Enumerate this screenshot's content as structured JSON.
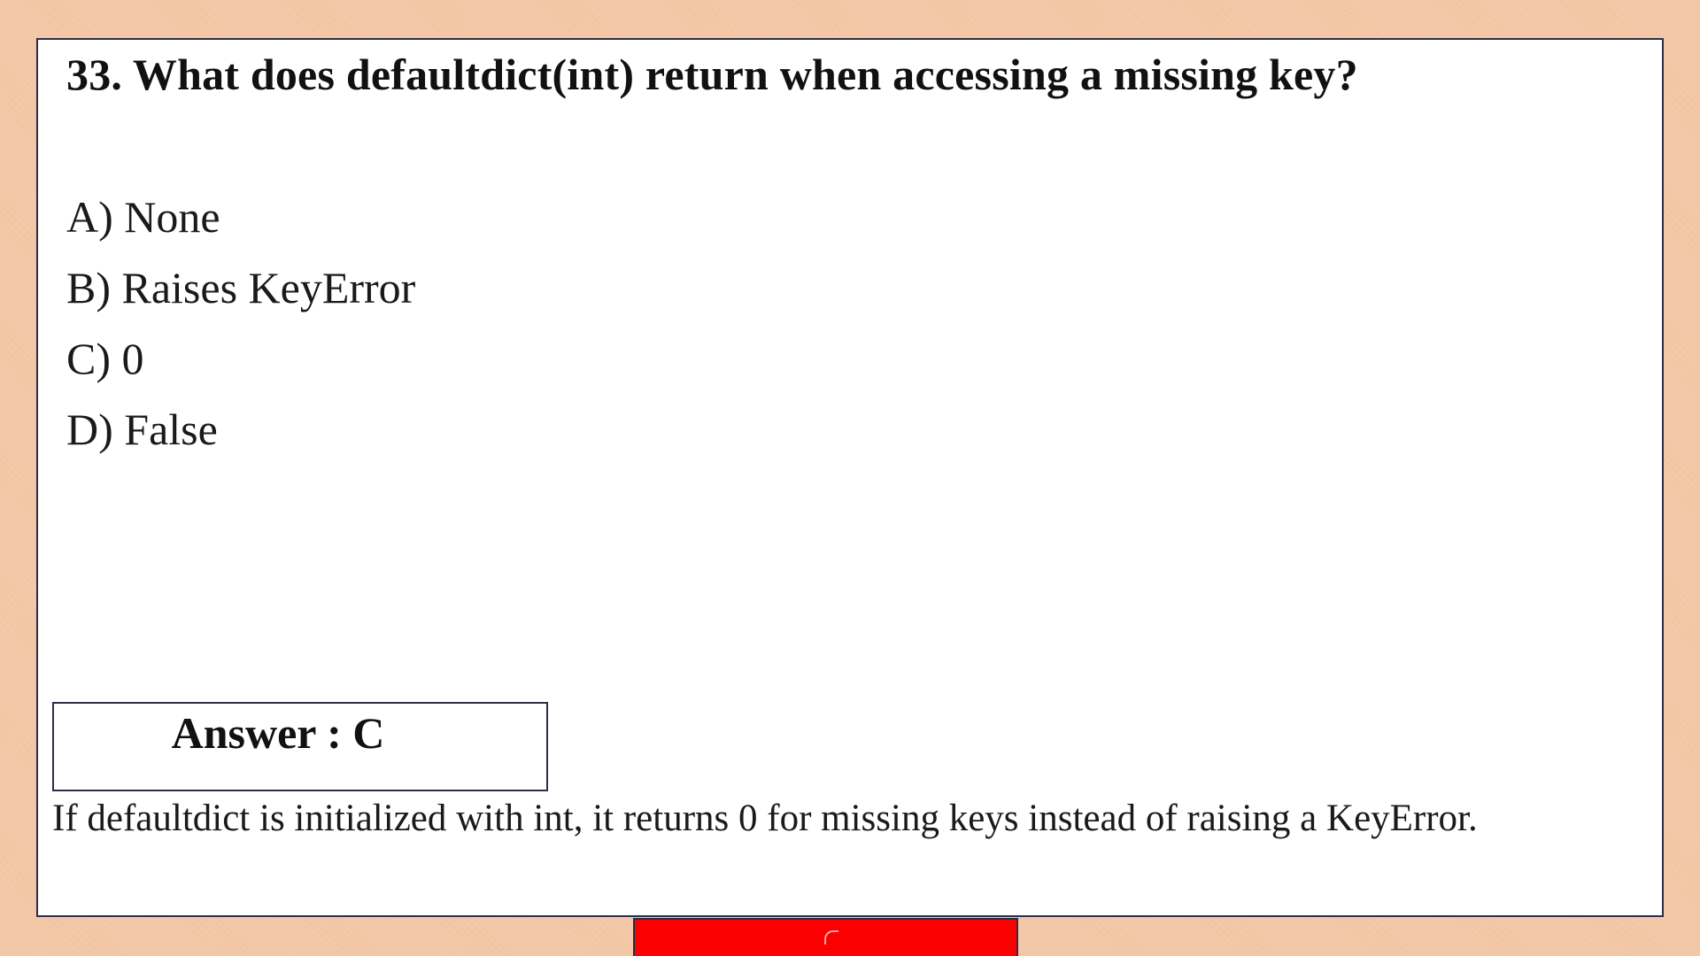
{
  "question": {
    "text": "33. What does defaultdict(int) return when accessing a missing key?"
  },
  "options": [
    {
      "label": "A) None"
    },
    {
      "label": "B) Raises KeyError"
    },
    {
      "label": "C) 0"
    },
    {
      "label": "D) False"
    }
  ],
  "answer": {
    "label": "Answer : C"
  },
  "explanation": {
    "text": "If defaultdict is initialized with int, it returns 0 for missing keys instead of raising a KeyError."
  },
  "colors": {
    "background": "#f3c6a3",
    "card": "#ffffff",
    "border": "#2d2f48",
    "bottom_bar": "#fb0000"
  }
}
